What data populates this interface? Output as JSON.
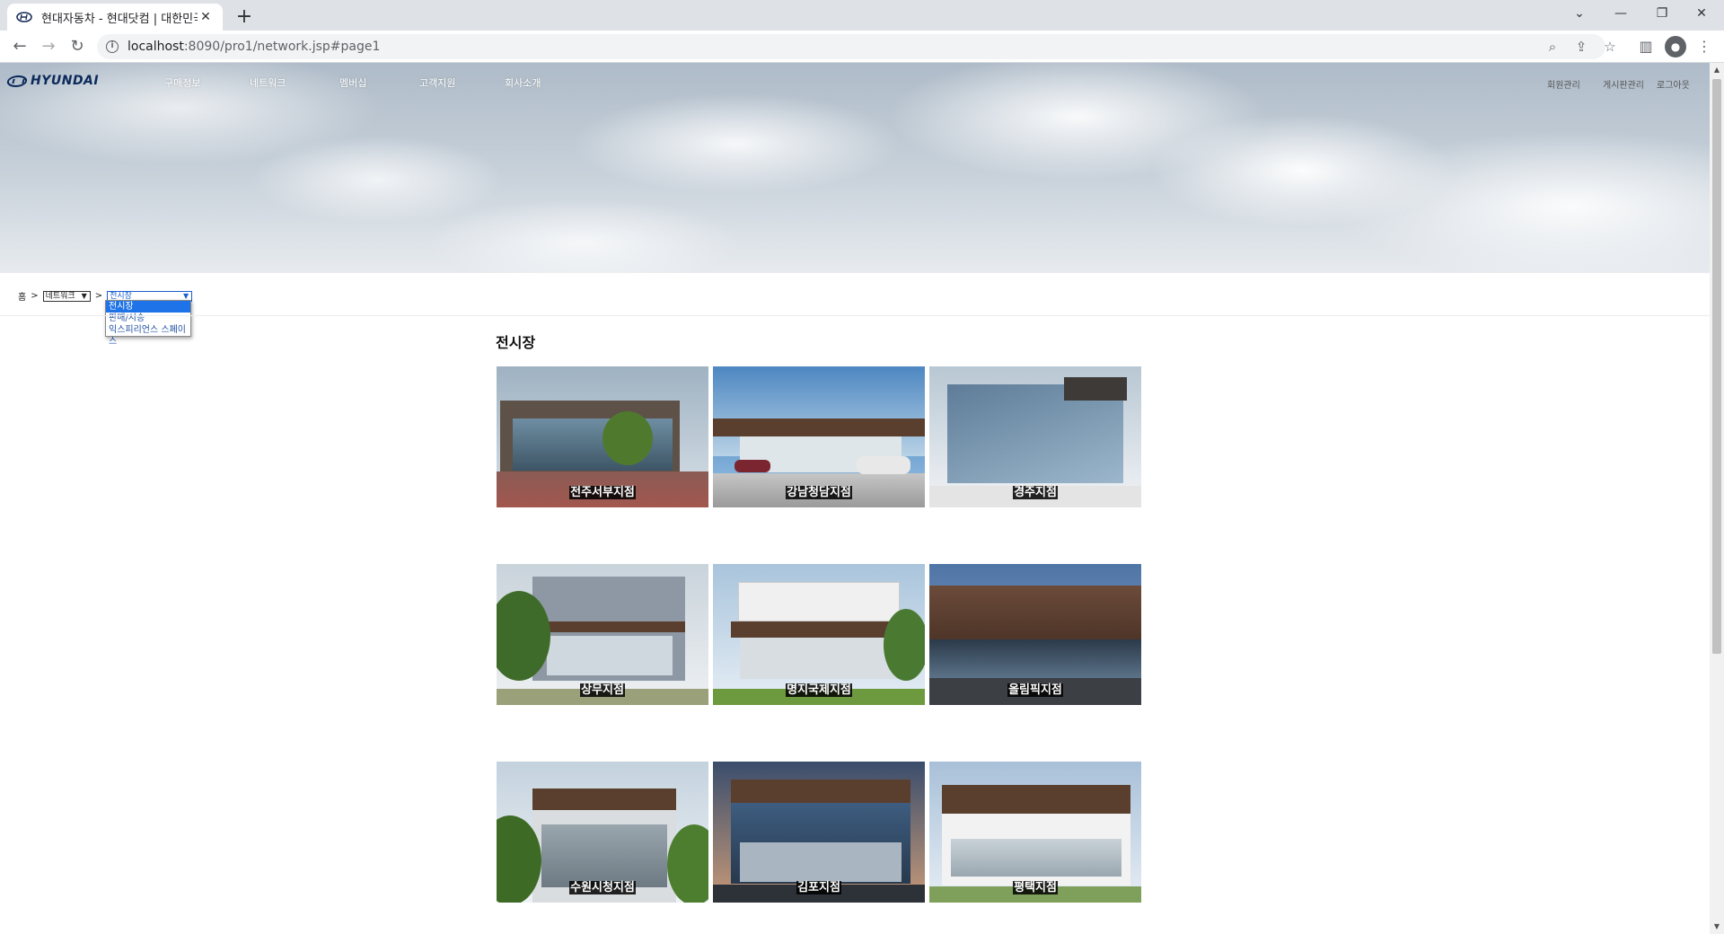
{
  "browser": {
    "tab_title": "현대자동차 - 현대닷컴 | 대한민국",
    "url_host": "localhost",
    "url_rest": ":8090/pro1/network.jsp#page1"
  },
  "site": {
    "logo_text": "HYUNDAI",
    "gnb": [
      "구매정보",
      "네트워크",
      "멤버십",
      "고객지원",
      "회사소개"
    ],
    "util": [
      "회원관리",
      "게시판관리",
      "로그아웃"
    ]
  },
  "breadcrumb": {
    "home": "홈",
    "sep": ">",
    "select1_value": "네트워크",
    "select2_value": "전시장",
    "select2_options": [
      "전시장",
      "판매/시승",
      "익스피리언스 스페이스"
    ]
  },
  "section_title": "전시장",
  "branches": [
    "전주서부지점",
    "강남청담지점",
    "경주지점",
    "상무지점",
    "명지국제지점",
    "올림픽지점",
    "수원시청지점",
    "김포지점",
    "평택지점"
  ],
  "colors": {
    "selected_option_bg": "#1e73e8",
    "label_bg": "#000000",
    "facade_brown": "#5a3f2e"
  }
}
